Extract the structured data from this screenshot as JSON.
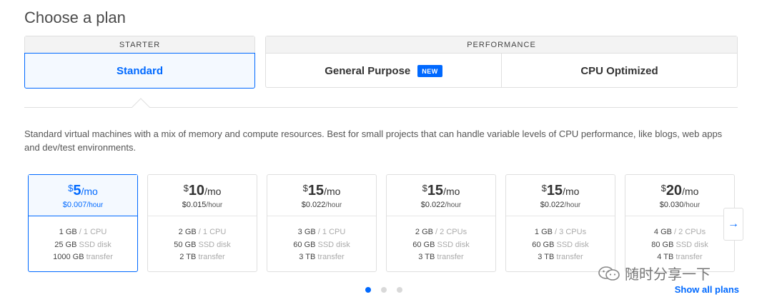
{
  "page": {
    "title": "Choose a plan"
  },
  "plan_types": {
    "starter": {
      "header": "STARTER",
      "option": "Standard"
    },
    "performance": {
      "header": "PERFORMANCE",
      "options": [
        {
          "label": "General Purpose",
          "badge": "NEW"
        },
        {
          "label": "CPU Optimized"
        }
      ]
    }
  },
  "description": "Standard virtual machines with a mix of memory and compute resources. Best for small projects that can handle variable levels of CPU performance, like blogs, web apps and dev/test environments.",
  "plans": [
    {
      "currency": "$",
      "price": "5",
      "per": "/mo",
      "hourly": "$0.007",
      "hourly_unit": "/hour",
      "memory": "1 GB",
      "cpu": " / 1 CPU",
      "disk": "25 GB",
      "disk_label": " SSD disk",
      "transfer": "1000 GB",
      "transfer_label": " transfer"
    },
    {
      "currency": "$",
      "price": "10",
      "per": "/mo",
      "hourly": "$0.015",
      "hourly_unit": "/hour",
      "memory": "2 GB",
      "cpu": " / 1 CPU",
      "disk": "50 GB",
      "disk_label": " SSD disk",
      "transfer": "2 TB",
      "transfer_label": " transfer"
    },
    {
      "currency": "$",
      "price": "15",
      "per": "/mo",
      "hourly": "$0.022",
      "hourly_unit": "/hour",
      "memory": "3 GB",
      "cpu": " / 1 CPU",
      "disk": "60 GB",
      "disk_label": " SSD disk",
      "transfer": "3 TB",
      "transfer_label": " transfer"
    },
    {
      "currency": "$",
      "price": "15",
      "per": "/mo",
      "hourly": "$0.022",
      "hourly_unit": "/hour",
      "memory": "2 GB",
      "cpu": " / 2 CPUs",
      "disk": "60 GB",
      "disk_label": " SSD disk",
      "transfer": "3 TB",
      "transfer_label": " transfer"
    },
    {
      "currency": "$",
      "price": "15",
      "per": "/mo",
      "hourly": "$0.022",
      "hourly_unit": "/hour",
      "memory": "1 GB",
      "cpu": " / 3 CPUs",
      "disk": "60 GB",
      "disk_label": " SSD disk",
      "transfer": "3 TB",
      "transfer_label": " transfer"
    },
    {
      "currency": "$",
      "price": "20",
      "per": "/mo",
      "hourly": "$0.030",
      "hourly_unit": "/hour",
      "memory": "4 GB",
      "cpu": " / 2 CPUs",
      "disk": "80 GB",
      "disk_label": " SSD disk",
      "transfer": "4 TB",
      "transfer_label": " transfer"
    }
  ],
  "selected_plan_index": 0,
  "carousel": {
    "next_icon": "arrow-right-icon",
    "next_glyph": "→",
    "current_page": 1,
    "total_pages": 3
  },
  "show_all_label": "Show all plans",
  "watermark": {
    "text": "随时分享一下"
  },
  "colors": {
    "accent": "#0069ff",
    "border": "#dfdfdf",
    "muted": "#aaaaaa"
  }
}
